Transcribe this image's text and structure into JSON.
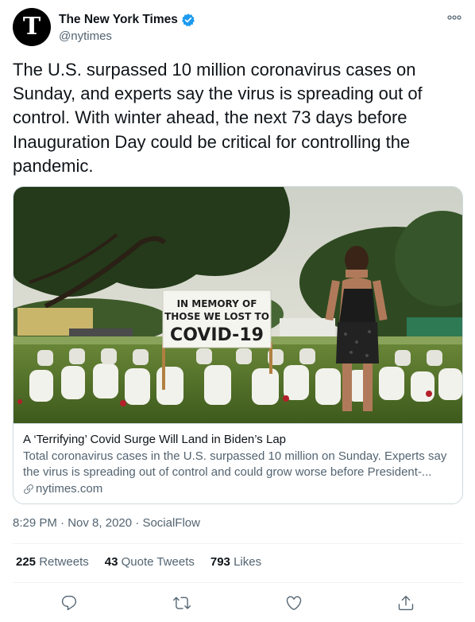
{
  "author": {
    "display_name": "The New York Times",
    "handle": "@nytimes",
    "avatar_letter": "T",
    "verified": true
  },
  "tweet": {
    "text": "The U.S. surpassed 10 million coronavirus cases on Sunday, and experts say the virus is spreading out of control. With winter ahead, the next 73 days before Inauguration Day could be critical for controlling the pandemic."
  },
  "card": {
    "sign_line1": "IN MEMORY OF",
    "sign_line2": "THOSE WE LOST TO",
    "sign_line3": "COVID-19",
    "title": "A ‘Terrifying’ Covid Surge Will Land in Biden’s Lap",
    "description": "Total coronavirus cases in the U.S. surpassed 10 million on Sunday. Experts say the virus is spreading out of control and could grow worse before President-...",
    "domain": "nytimes.com"
  },
  "meta": {
    "time": "8:29 PM",
    "date": "Nov 8, 2020",
    "source": "SocialFlow",
    "sep": "·"
  },
  "stats": {
    "retweets_count": "225",
    "retweets_label": "Retweets",
    "quotes_count": "43",
    "quotes_label": "Quote Tweets",
    "likes_count": "793",
    "likes_label": "Likes"
  },
  "colors": {
    "text": "#0f1419",
    "secondary": "#536471",
    "border": "#cfd9de",
    "verified": "#1d9bf0"
  },
  "icons": [
    "verified-badge-icon",
    "more-icon",
    "link-icon",
    "reply-icon",
    "retweet-icon",
    "like-icon",
    "share-icon"
  ]
}
